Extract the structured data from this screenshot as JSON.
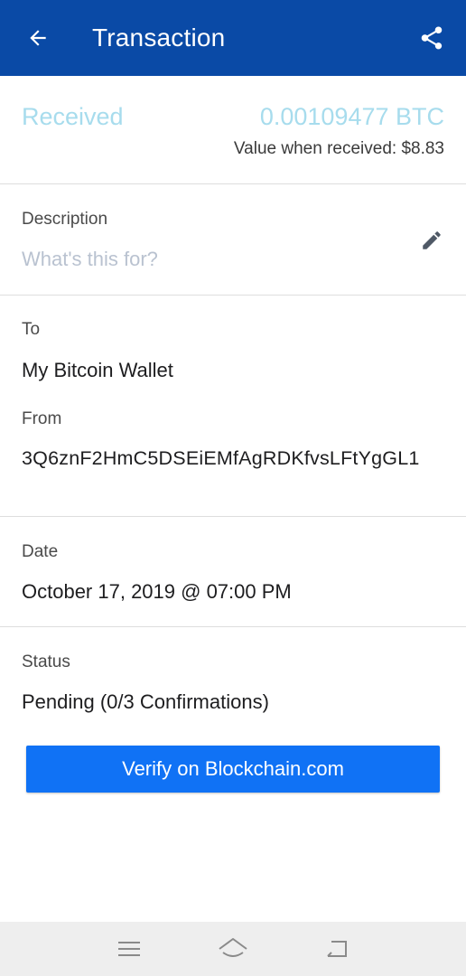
{
  "appbar": {
    "title": "Transaction",
    "back_icon": "arrow-left-icon",
    "share_icon": "share-icon",
    "background": "#0a4aa6"
  },
  "summary": {
    "type": "Received",
    "amount": "0.00109477 BTC",
    "value_when_received": "Value when received: $8.83",
    "accent_color": "#a7dced"
  },
  "description": {
    "label": "Description",
    "placeholder": "What's this for?",
    "edit_icon": "pencil-icon"
  },
  "to": {
    "label": "To",
    "value": "My Bitcoin Wallet"
  },
  "from": {
    "label": "From",
    "value": "3Q6znF2HmC5DSEiEMfAgRDKfvsLFtYgGL1"
  },
  "date": {
    "label": "Date",
    "value": "October 17, 2019 @ 07:00 PM"
  },
  "status": {
    "label": "Status",
    "value": "Pending (0/3 Confirmations)"
  },
  "verify_button": {
    "label": "Verify on Blockchain.com",
    "color": "#1072f5"
  },
  "system_nav": {
    "icons": [
      "menu-icon",
      "home-icon",
      "back-icon"
    ]
  }
}
